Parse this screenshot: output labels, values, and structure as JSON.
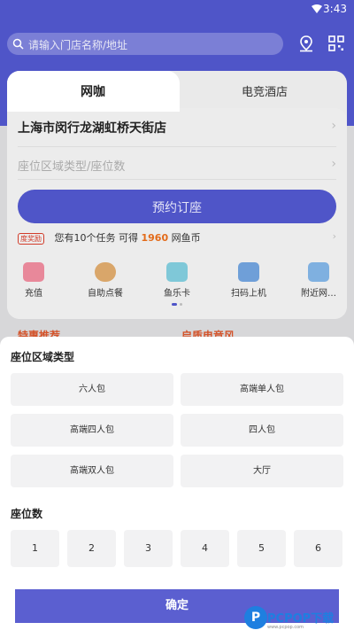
{
  "status_bar": {
    "time": "3:43"
  },
  "search": {
    "placeholder": "请输入门店名称/地址"
  },
  "tabs": [
    {
      "label": "网咖"
    },
    {
      "label": "电竞酒店"
    }
  ],
  "card": {
    "store_name": "上海市闵行龙湖虹桥天街店",
    "seat_placeholder": "座位区域类型/座位数",
    "reserve_label": "预约订座"
  },
  "task": {
    "badge": "度奖励",
    "prefix": "您有10个任务 可得",
    "amount": "1960",
    "suffix": "网鱼币"
  },
  "quick_actions": [
    {
      "label": "充值"
    },
    {
      "label": "自助点餐"
    },
    {
      "label": "鱼乐卡"
    },
    {
      "label": "扫码上机"
    },
    {
      "label": "附近网…"
    }
  ],
  "peek": {
    "left": "特惠推荐",
    "right": "启质电竞风"
  },
  "sheet": {
    "area_title": "座位区域类型",
    "areas": [
      "六人包",
      "高端单人包",
      "高端四人包",
      "四人包",
      "高端双人包",
      "大厅"
    ],
    "count_title": "座位数",
    "counts": [
      "1",
      "2",
      "3",
      "4",
      "5",
      "6"
    ],
    "confirm_label": "确定"
  },
  "watermark": {
    "logo": "P",
    "text": "PCPOP下载",
    "sub": "www.pcpop.com"
  },
  "colors": {
    "brand": "#4f55c8",
    "confirm": "#5b5fd0",
    "accent": "#e36b1a"
  }
}
